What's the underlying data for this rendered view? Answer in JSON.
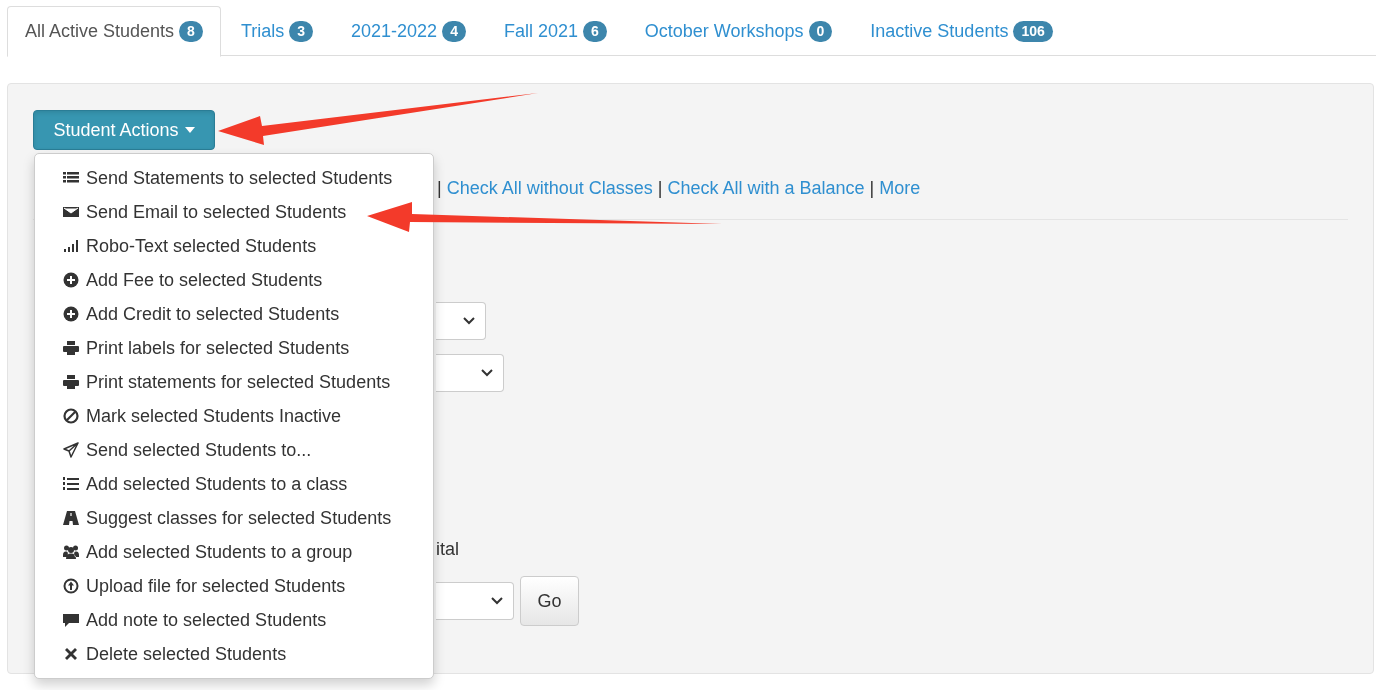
{
  "tabs": [
    {
      "label": "All Active Students",
      "count": "8",
      "selected": true
    },
    {
      "label": "Trials",
      "count": "3",
      "selected": false
    },
    {
      "label": "2021-2022",
      "count": "4",
      "selected": false
    },
    {
      "label": "Fall 2021",
      "count": "6",
      "selected": false
    },
    {
      "label": "October Workshops",
      "count": "0",
      "selected": false
    },
    {
      "label": "Inactive Students",
      "count": "106",
      "selected": false
    }
  ],
  "actions_button": {
    "label": "Student Actions",
    "expanded": true
  },
  "actions_menu": [
    {
      "label": "Send Statements to selected Students"
    },
    {
      "label": "Send Email to selected Students"
    },
    {
      "label": "Robo-Text selected Students"
    },
    {
      "label": "Add Fee to selected Students"
    },
    {
      "label": "Add Credit to selected Students"
    },
    {
      "label": "Print labels for selected Students"
    },
    {
      "label": "Print statements for selected Students"
    },
    {
      "label": "Mark selected Students Inactive"
    },
    {
      "label": "Send selected Students to..."
    },
    {
      "label": "Add selected Students to a class"
    },
    {
      "label": "Suggest classes for selected Students"
    },
    {
      "label": "Add selected Students to a group"
    },
    {
      "label": "Upload file for selected Students"
    },
    {
      "label": "Add note to selected Students"
    },
    {
      "label": "Delete selected Students"
    }
  ],
  "check_links": [
    {
      "kind": "separator",
      "text": "|"
    },
    {
      "kind": "link",
      "text": "Check All without Classes"
    },
    {
      "kind": "separator",
      "text": "|"
    },
    {
      "kind": "link",
      "text": "Check All with a Balance"
    },
    {
      "kind": "separator",
      "text": "|"
    },
    {
      "kind": "link",
      "text": "More"
    }
  ],
  "form_rows": [
    {
      "kind": "select"
    },
    {
      "kind": "select"
    },
    {
      "kind": "text",
      "text": "ital"
    },
    {
      "kind": "select-go",
      "button": "Go"
    }
  ]
}
